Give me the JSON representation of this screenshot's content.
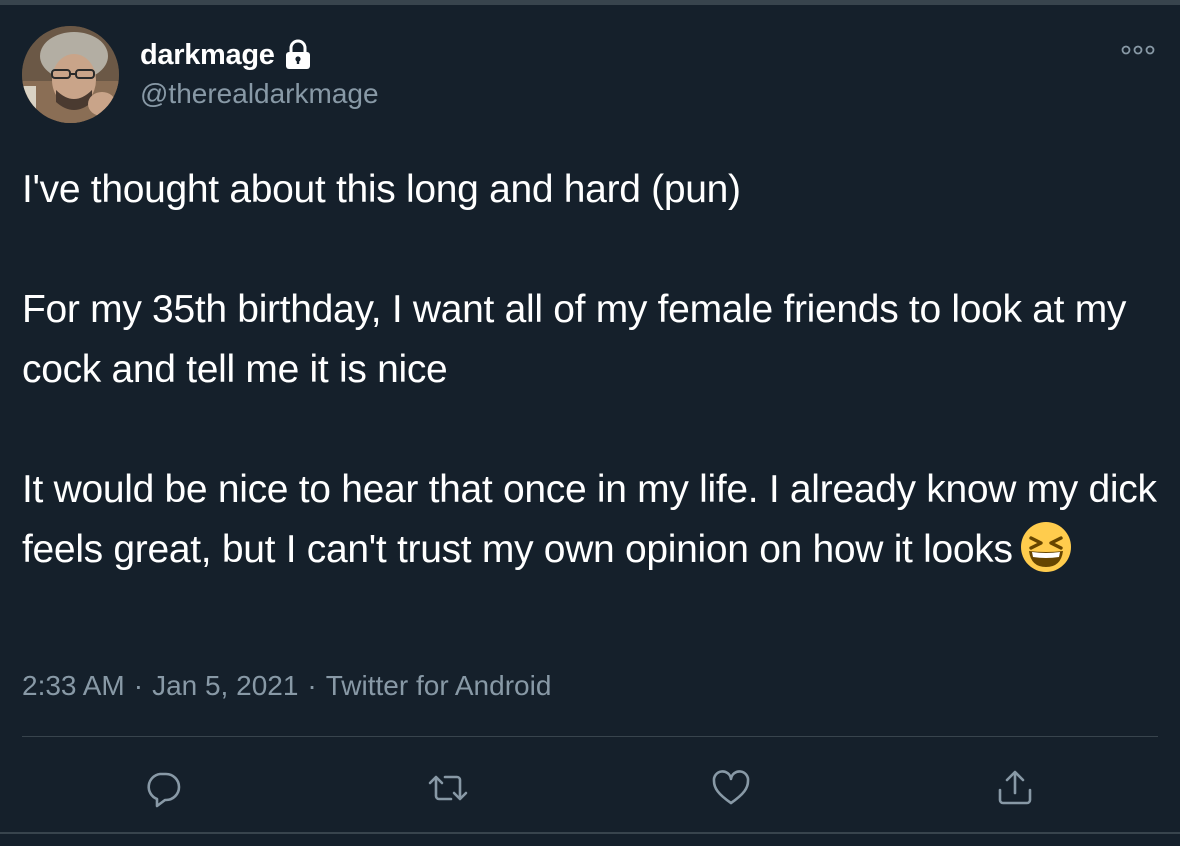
{
  "tweet": {
    "author": {
      "display_name": "darkmage",
      "handle": "@therealdarkmage",
      "protected_icon": "lock-icon"
    },
    "text_lines": {
      "p1": "I've thought about this long and hard (pun)",
      "p2": "For my 35th birthday, I want all of my female friends to look at my cock and tell me it is nice",
      "p3": "It would be nice to hear that once in my life. I already know my dick feels great, but I can't trust my own opinion on how it looks"
    },
    "emoji": "grinning-squinting-face",
    "time": "2:33 AM",
    "separator": "·",
    "date": "Jan 5, 2021",
    "source": "Twitter for Android",
    "actions": [
      "reply-icon",
      "retweet-icon",
      "like-icon",
      "share-icon"
    ],
    "more_icon": "more-icon"
  },
  "colors": {
    "background": "#15202b",
    "text": "#ffffff",
    "muted": "#8899a6",
    "border": "#38444d"
  }
}
